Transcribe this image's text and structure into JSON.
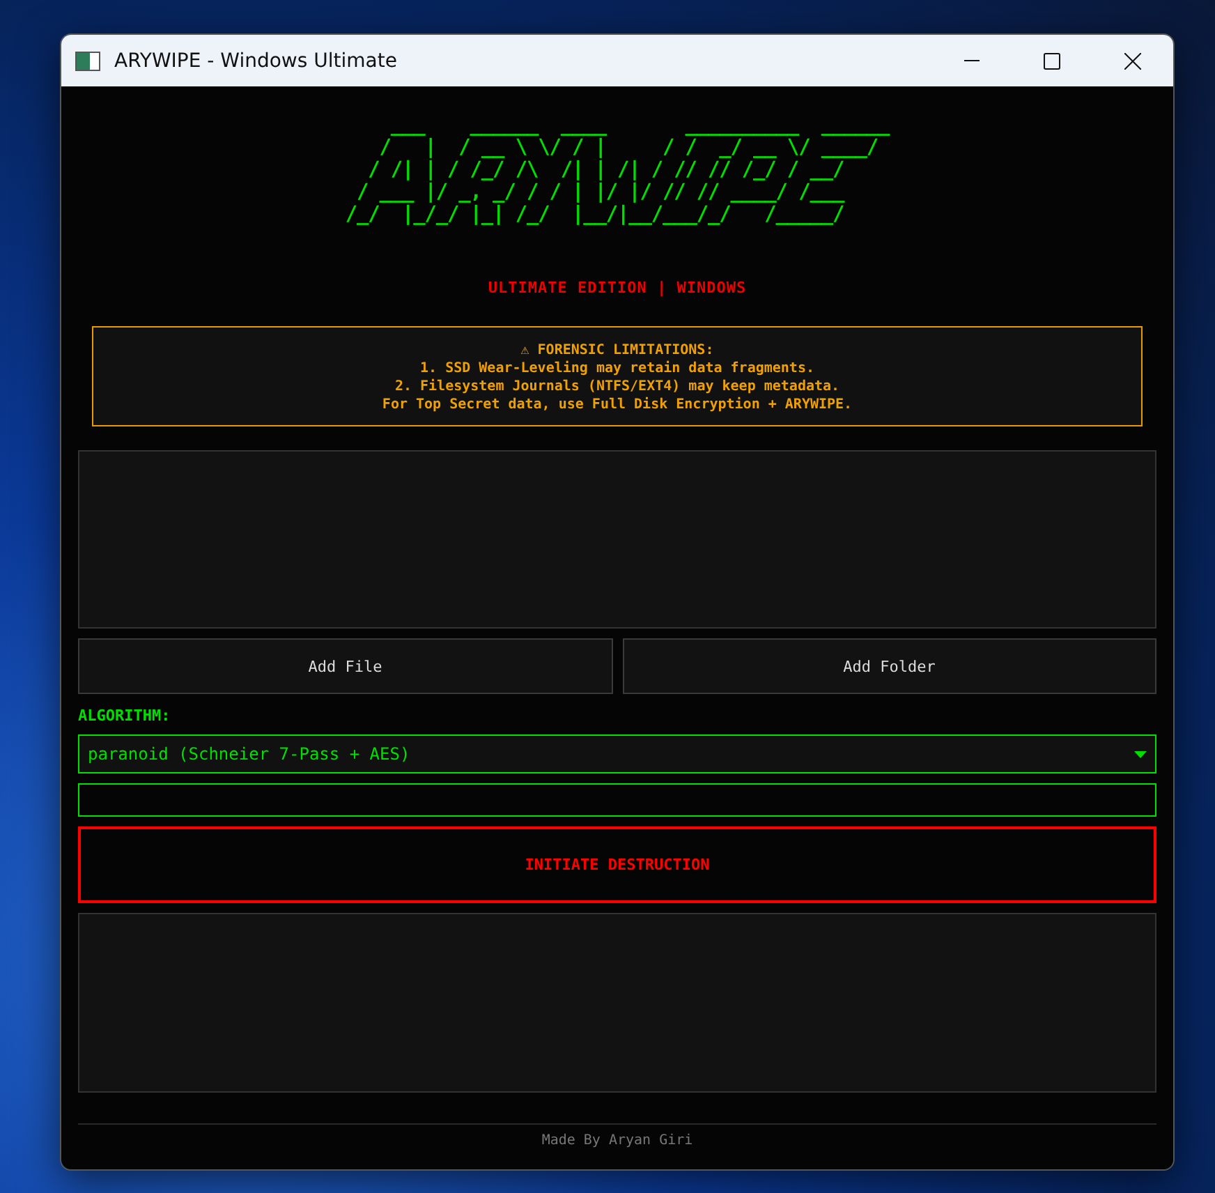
{
  "window": {
    "title": "ARYWIPE - Windows Ultimate"
  },
  "logo_art": "    ___    ______  ____       __________  ______\n   /   |  / __ \\ \\/ / |     / /  _/ __ \\/ ____/\n  / /| | / /_/ /\\  /| | /| / // // /_/ / __/   \n / ___ |/ _, _/ / / | |/ |/ // // ____/ /___   \n/_/  |_/_/ |_| /_/  |__/|__/___/_/   /_____/   ",
  "subtitle": "ULTIMATE EDITION | WINDOWS",
  "warning": {
    "icon": "⚠",
    "title": "FORENSIC LIMITATIONS:",
    "lines": [
      "1. SSD Wear-Leveling may retain data fragments.",
      "2. Filesystem Journals (NTFS/EXT4) may keep metadata.",
      "For Top Secret data, use Full Disk Encryption + ARYWIPE."
    ]
  },
  "buttons": [
    "Add File",
    "Add Folder"
  ],
  "algorithm": {
    "label": "ALGORITHM:",
    "value": "paranoid (Schneier 7-Pass + AES)"
  },
  "action_button": "INITIATE DESTRUCTION",
  "footer": "Made By Aryan Giri"
}
